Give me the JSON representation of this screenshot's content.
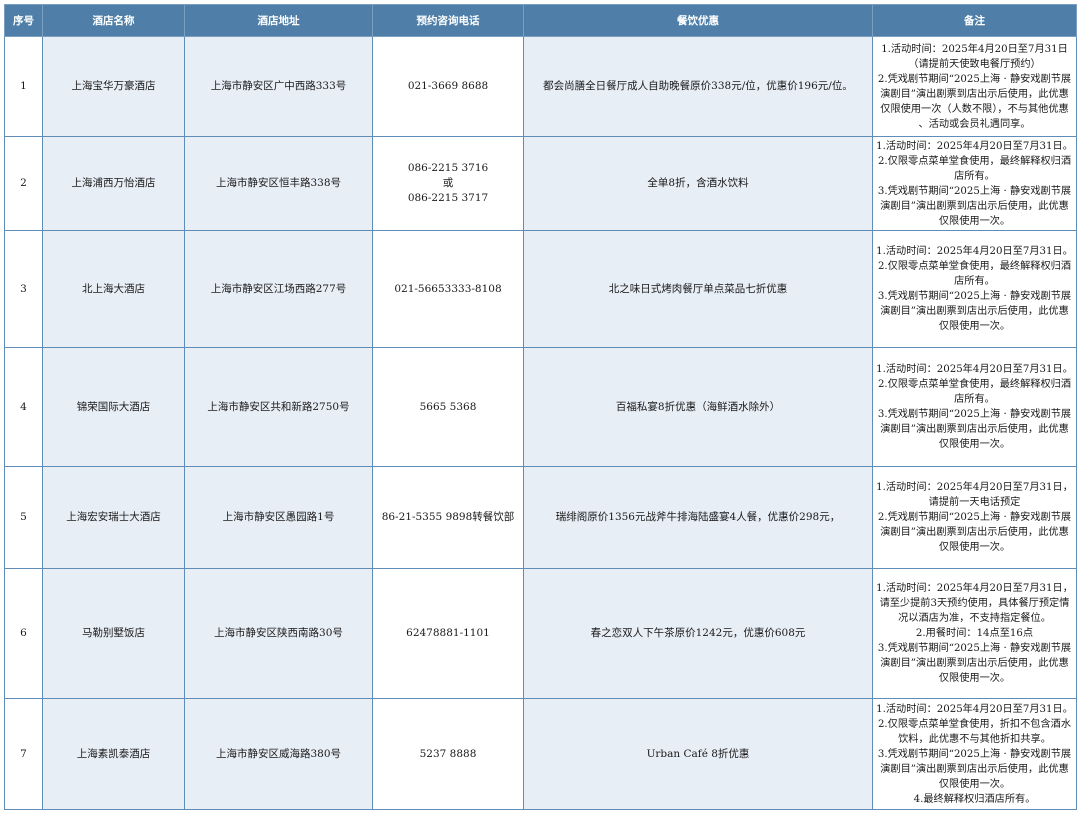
{
  "headers": [
    "序号",
    "酒店名称",
    "酒店地址",
    "预约咨询电话",
    "餐饮优惠",
    "备注"
  ],
  "rows": [
    {
      "no": "1",
      "name": "上海宝华万豪酒店",
      "address": "上海市静安区广中西路333号",
      "phone": [
        "021-3669 8688"
      ],
      "offer": "都会尚膳全日餐厅成人自助晚餐原价338元/位，优惠价196元/位。",
      "remarks": [
        "1.活动时间：2025年4月20日至7月31日",
        "（请提前天使致电餐厅预约）",
        "2.凭戏剧节期间“2025上海 · 静安戏剧节展",
        "演剧目”演出剧票到店出示后使用，此优惠",
        "仅限使用一次（人数不限），不与其他优惠",
        "、活动或会员礼遇同享。"
      ]
    },
    {
      "no": "2",
      "name": "上海浦西万怡酒店",
      "address": "上海市静安区恒丰路338号",
      "phone": [
        "086-2215 3716",
        "或",
        "086-2215 3717"
      ],
      "offer": "全单8折，含酒水饮料",
      "remarks": [
        "1.活动时间：2025年4月20日至7月31日。",
        "2.仅限零点菜单堂食使用，最终解释权归酒",
        "店所有。",
        "3.凭戏剧节期间“2025上海 · 静安戏剧节展",
        "演剧目”演出剧票到店出示后使用，此优惠",
        "仅限使用一次。"
      ]
    },
    {
      "no": "3",
      "name": "北上海大酒店",
      "address": "上海市静安区江场西路277号",
      "phone": [
        "021-56653333-8108"
      ],
      "offer": "北之味日式烤肉餐厅单点菜品七折优惠",
      "remarks": [
        "1.活动时间：2025年4月20日至7月31日。",
        "2.仅限零点菜单堂食使用，最终解释权归酒",
        "店所有。",
        "3.凭戏剧节期间“2025上海 · 静安戏剧节展",
        "演剧目”演出剧票到店出示后使用，此优惠",
        "仅限使用一次。"
      ]
    },
    {
      "no": "4",
      "name": "锦荣国际大酒店",
      "address": "上海市静安区共和新路2750号",
      "phone": [
        "5665 5368"
      ],
      "offer": "百福私宴8折优惠（海鲜酒水除外）",
      "remarks": [
        "1.活动时间：2025年4月20日至7月31日。",
        "2.仅限零点菜单堂食使用，最终解释权归酒",
        "店所有。",
        "3.凭戏剧节期间“2025上海 · 静安戏剧节展",
        "演剧目”演出剧票到店出示后使用，此优惠",
        "仅限使用一次。"
      ]
    },
    {
      "no": "5",
      "name": "上海宏安瑞士大酒店",
      "address": "上海市静安区愚园路1号",
      "phone": [
        "86-21-5355 9898转餐饮部"
      ],
      "offer": "瑞绯阁原价1356元战斧牛排海陆盛宴4人餐，优惠价298元，",
      "remarks": [
        "1.活动时间：2025年4月20日至7月31日，",
        "请提前一天电话预定",
        "2.凭戏剧节期间“2025上海 · 静安戏剧节展",
        "演剧目”演出剧票到店出示后使用，此优惠",
        "仅限使用一次。"
      ]
    },
    {
      "no": "6",
      "name": "马勒别墅饭店",
      "address": "上海市静安区陕西南路30号",
      "phone": [
        "62478881-1101"
      ],
      "offer": "春之恋双人下午茶原价1242元，优惠价608元",
      "remarks": [
        "1.活动时间：2025年4月20日至7月31日，",
        "请至少提前3天预约使用，具体餐厅预定情",
        "况以酒店为准，不支持指定餐位。",
        "2.用餐时间：14点至16点",
        "3.凭戏剧节期间“2025上海 · 静安戏剧节展",
        "演剧目”演出剧票到店出示后使用，此优惠",
        "仅限使用一次。"
      ]
    },
    {
      "no": "7",
      "name": "上海素凯泰酒店",
      "address": "上海市静安区威海路380号",
      "phone": [
        "5237 8888"
      ],
      "offer": "Urban Café 8折优惠",
      "remarks": [
        "1.活动时间：2025年4月20日至7月31日。",
        "2.仅限零点菜单堂食使用，折扣不包含酒水",
        "饮料，此优惠不与其他折扣共享。",
        "3.凭戏剧节期间“2025上海 · 静安戏剧节展",
        "演剧目”演出剧票到店出示后使用，此优惠",
        "仅限使用一次。",
        "4.最终解释权归酒店所有。"
      ]
    }
  ]
}
